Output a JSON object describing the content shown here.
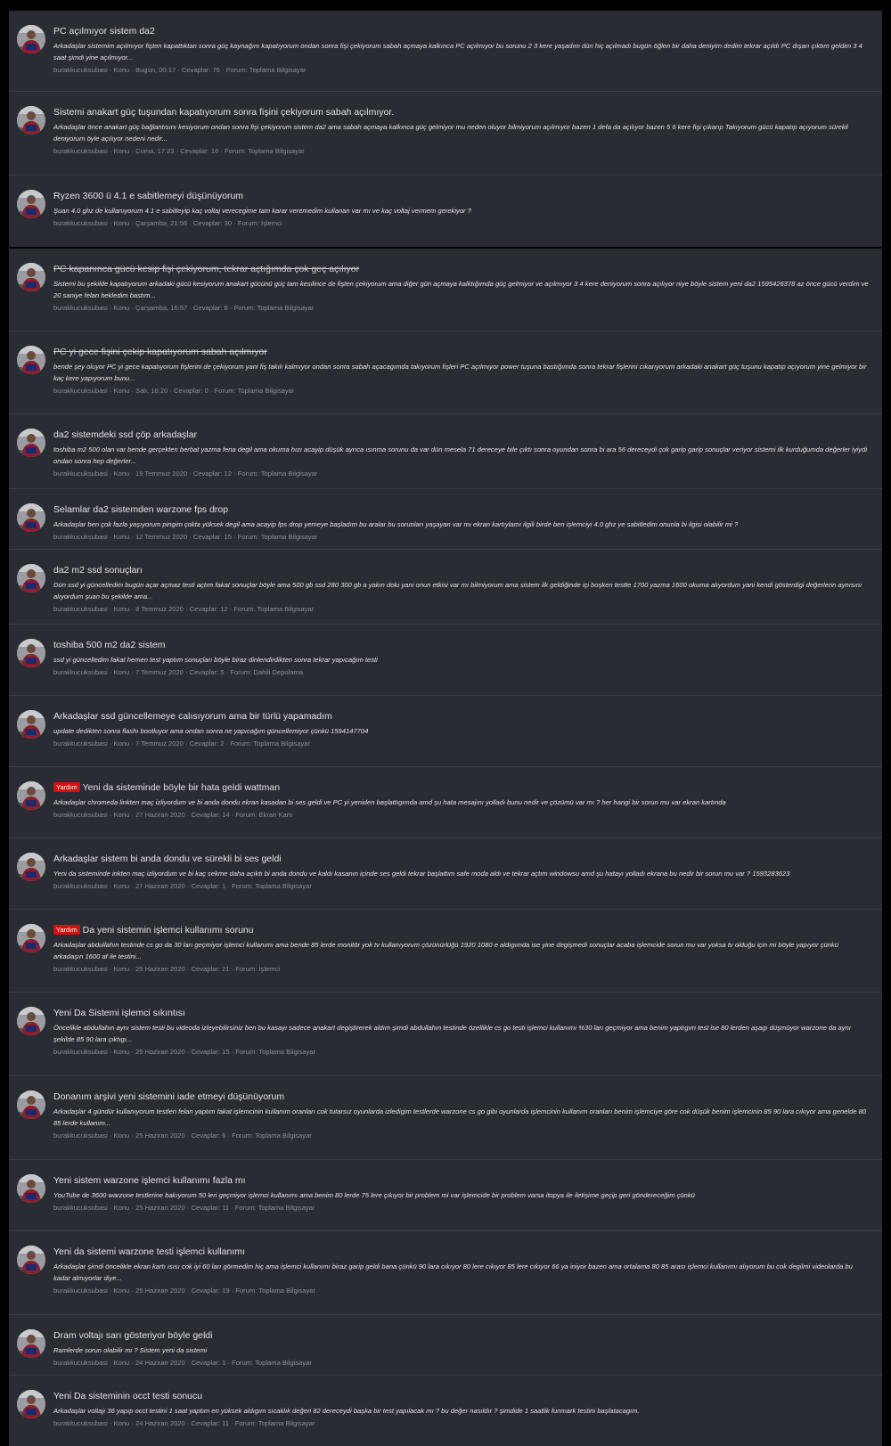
{
  "threads": [
    {
      "title": "PC açılmıyor sistem da2",
      "snippet": "Arkadaşlar sistemim açılmıyor fişten kapattıktan sonra güç kaynağını kapatıyorum ondan sonra fişi çekiyorum sabah açmaya kalkınca PC açılmıyor bu sorunu 2 3 kere yaşadım dün hiç açılmadı bugün öğlen bir daha deniyim dedim tekrar açıldı PC dışarı çıktım geldim 3 4 saat şimdi yine açılmıyor...",
      "meta": "burakkucuksubasi · Konu · Bugün, 00:17 · Cevaplar: 76 · Forum: Toplama Bilgisayar"
    },
    {
      "title": "Sistemi anakart güç tuşundan kapatıyorum sonra fişini çekiyorum sabah açılmıyor.",
      "snippet": "Arkadaşlar önce anakart güç bağlantısını kesiyorum ondan sonra fişi çekiyorum sistem da2 ama sabah açmaya kalkınca güç gelmiyor mu neden oluyor bilmiyorum açılmıyor bazen 1 defa da açılıyor bazen 5 6 kere fişi çıkarıp Takıyorum gücü kapatıp açıyorum sürekli deniyorum öyle açılıyor nedeni nedir...",
      "meta": "burakkucuksubasi · Konu · Cuma, 17:23 · Cevaplar: 16 · Forum: Toplama Bilgisayar"
    },
    {
      "title": "Ryzen 3600 ü 4.1 e sabitlemeyi düşünüyorum",
      "snippet": "Şuan 4.0 ghz de kullanıyorum 4.1 e sabitleyip kaç voltaj verecegime tam karar veremedim kullanan var mı ve kaç voltaj vermem gerekiyor ?",
      "meta": "burakkucuksubasi · Konu · Çarşamba, 21:56 · Cevaplar: 30 · Forum: İşlemci"
    },
    {
      "title": "PC kapanınca gücü kesip fişi çekiyorum, tekrar açtığımda çok geç açılıyor",
      "snippet": "Sistemi bu şekilde kapatıyorum arkadaki gücü kesiyorum anakart gücünü güç tam kesilince de fişten çekiyorum ama diğer gün açmaya kalktığımda güç gelmiyor ve açılmıyor 3 4 kere deniyorum sonra açılıyor niye böyle sistem yeni da2 1595426378 az önce gücü verdim ve 20 saniye felan bekledim bastım...",
      "meta": "burakkucuksubasi · Konu · Çarşamba, 16:57 · Cevaplar: 8 · Forum: Toplama Bilgisayar"
    },
    {
      "title": "PC yi gece fişini çekip kapatıyorum sabah açılmıyor",
      "snippet": "bende şey oluyor PC yi gece kapatıyorum fişlerini de çekiyorum yani fiş takılı kalmıyor ondan sonra sabah açacagımda takıyorum fişleri PC açılmıyor power tuşuna bastığımda sonra tekrar fişlerini cıkarıyorum arkadaki anakart güç tuşunu kapatıp açıyorum yine gelmiyor bir kaç kere yapıyorum bunu...",
      "meta": "burakkucuksubasi · Konu · Salı, 18:20 · Cevaplar: 0 · Forum: Toplama Bilgisayar"
    },
    {
      "title": "da2 sistemdeki ssd çöp arkadaşlar",
      "snippet": "toshiba m2 500 olan var bende gerçekten berbat yazma fena degil ama okuma hızı acayip düşük ayrıca ısınma sorunu da var dün mesela 71 dereceye bile çıktı sonra oyundan sonra bi ara 56 dereceydi çok garip garip sonuçlar veriyor sistemi ilk kurduğumda değerler iyiydi ondan sonra hep değerler...",
      "meta": "burakkucuksubasi · Konu · 19 Temmuz 2020 · Cevaplar: 12 · Forum: Toplama Bilgisayar"
    },
    {
      "title": "Selamlar da2 sistemden warzone fps drop",
      "snippet": "Arkadaşlar ben çok fazla yaşıyorum pingim çokta yüksek degil ama acayip fps drop yemeye başladım bu aralar bu sorunları yaşayan var mı ekran kartıylamı ilgili birde ben işlemciyi 4.0 ghz ye sabitledim onunla bi ilgisi olabilir mi ?",
      "meta": "burakkucuksubasi · Konu · 12 Temmuz 2020 · Cevaplar: 15 · Forum: Toplama Bilgisayar"
    },
    {
      "title": "da2 m2 ssd sonuçları",
      "snippet": "Dün ssd yi güncelledim bugün açar açmaz testi açtım fakat sonuçlar böyle ama 500 gb ssd 280 300 gb a yakın dolu yani onun etkisi var mı bilmiyorum ama sistem ilk geldiğinde içi boşken testte 1700 yazma 1600 okuma alıyordum yani kendi gösterdigi değerlerin aynısını alıyordum şuan bu şekilde ama...",
      "meta": "burakkucuksubasi · Konu · 8 Temmuz 2020 · Cevaplar: 12 · Forum: Toplama Bilgisayar"
    },
    {
      "title": "toshiba 500 m2 da2 sistem",
      "snippet": "ssd yi güncelledim fakat hemen test yaptım sonuçları böyle biraz dinlendirdikten sonra tekrar yapıcağım testi",
      "meta": "burakkucuksubasi · Konu · 7 Temmuz 2020 · Cevaplar: 5 · Forum: Dahili Depolama"
    },
    {
      "title": "Arkadaşlar ssd güncellemeye calısıyorum ama bir türlü yapamadım",
      "snippet": "update dedikten sonra flashı bootluyor ama ondan sonra ne yapıcağım güncellemiyor çünkü 1594147704",
      "meta": "burakkucuksubasi · Konu · 7 Temmuz 2020 · Cevaplar: 2 · Forum: Toplama Bilgisayar"
    },
    {
      "tag": "Yardım",
      "title": "Yeni da sisteminde böyle bir hata geldi wattman",
      "snippet": "Arkadaşlar chromeda linkten maç izliyordum ve bi anda dondu ekran kasadan bi ses geldi ve PC yi yeniden başlattıgımda amd şu hata mesajını yolladı bunu nedir ve çözümü var mı ? her hangi bir sorun mu var ekran kartında",
      "meta": "burakkucuksubasi · Konu · 27 Haziran 2020 · Cevaplar: 14 · Forum: Ekran Kartı"
    },
    {
      "title": "Arkadaşlar sistem bi anda dondu ve sürekli bi ses geldi",
      "snippet": "Yeni da sisteminde inkten maç izliyordum ve bi kaç sekme daha açıktı bi anda dondu ve kaldı kasanın içinde ses geldi tekrar başlattım safe moda aldı ve tekrar açtım windowsu amd şu hatayı yolladı ekrana bu nedir bir sorun mu var ? 1593283623",
      "meta": "burakkucuksubasi · Konu · 27 Haziran 2020 · Cevaplar: 1 · Forum: Toplama Bilgisayar"
    },
    {
      "tag": "Yardım",
      "title": "Da yeni sistemin işlemci kullanımı sorunu",
      "snippet": "Arkadaşlar abdullahın testinde cs go da 30 ları geçmiyor işlemci kullanımı ama bende 85 lerde monitör yok tv kullanıyorum çözünürlüğü 1920 1080 e aldıgımda ise yine degişmedi sonuçlar acaba işlemcide sorun mu var yoksa tv olduğu için mi böyle yapıyor çünkü arkadaşın 1600 af ile testini...",
      "meta": "burakkucuksubasi · Konu · 25 Haziran 2020 · Cevaplar: 21 · Forum: İşlemci"
    },
    {
      "title": "Yeni Da Sistemi işlemci sıkıntısı",
      "snippet": "Öncelikle abdullahın aynı sistem testi bu videoda izleyebilirsiniz ben bu kasayı sadece anakart degiştirerek aldım şimdi abdullahın testinde özellikle cs go testi işlemci kullanımı %30 ları geçmiyor ama benim yaptıgım test ise 80 lerden aşagı düşmüyor warzone da aynı şekilde 85 90 lara çıktıgı...",
      "meta": "burakkucuksubasi · Konu · 25 Haziran 2020 · Cevaplar: 15 · Forum: Toplama Bilgisayar"
    },
    {
      "title": "Donanım arşivi yeni sistemini iade etmeyi düşünüyorum",
      "snippet": "Arkadaşlar 4 gündür kullanıyorum testleri felan yaptım fakat işlemcinin kullanım oranları cok tutarsız oyunlarda izledigim testlerde warzone cs go gibi oyunlarda işlemcinin kullanım oranları benim işlemciye göre cok düşük benim işlemcinin 85 90 lara cıkıyor ama genelde 80 85 lerde kullanım...",
      "meta": "burakkucuksubasi · Konu · 25 Haziran 2020 · Cevaplar: 6 · Forum: Toplama Bilgisayar"
    },
    {
      "title": "Yeni sistem warzone işlemci kullanımı fazla mı",
      "snippet": "YouTube de 3600 warzone testlerine bakıyorum 50 leri geçmiyor işlemci kullanımı ama benim 80 lerde 75 lere çıkıyor bir problem mi var işlemcide bir problem varsa itopya ile iletişime geçip geri göndereceğim çünkü",
      "meta": "burakkucuksubasi · Konu · 25 Haziran 2020 · Cevaplar: 11 · Forum: Toplama Bilgisayar"
    },
    {
      "title": "Yeni da sistemi warzone testi işlemci kullanımı",
      "snippet": "Arkadaşlar şimdi öncelikle ekran kartı ısısı cok iyi 60 ları görmedim hiç ama işlemci kullanımı biraz garip geldi bana çünkü 90 lara cıkıyor 80 lere cıkıyor 85 lere cıkıyor 66 ya iniyor bazen ama ortalama 80 85 arası işlemci kullanımı alıyorum bu cok degilmi videolarda bu kadar almıyorlar diye...",
      "meta": "burakkucuksubasi · Konu · 25 Haziran 2020 · Cevaplar: 19 · Forum: Toplama Bilgisayar"
    },
    {
      "title": "Dram voltajı sarı gösteriyor böyle geldi",
      "snippet": "Ramlerde sorun olabilir mi ? Sistem yeni da sistemi",
      "meta": "burakkucuksubasi · Konu · 24 Haziran 2020 · Cevaplar: 1 · Forum: Toplama Bilgisayar"
    },
    {
      "title": "Yeni Da sisteminin occt testi sonucu",
      "snippet": "Arkadaşlar voltajı 36 yapıp occt testini 1 saat yaptım en yüksek aldıgım sıcaklık değeri 82 dereceydi başka bir test yapılacak mı ? bu değer nasıldır ? şimdide 1 saatlik funmark testini başlatacagım.",
      "meta": "burakkucuksubasi · Konu · 24 Haziran 2020 · Cevaplar: 11 · Forum: Toplama Bilgisayar"
    }
  ]
}
